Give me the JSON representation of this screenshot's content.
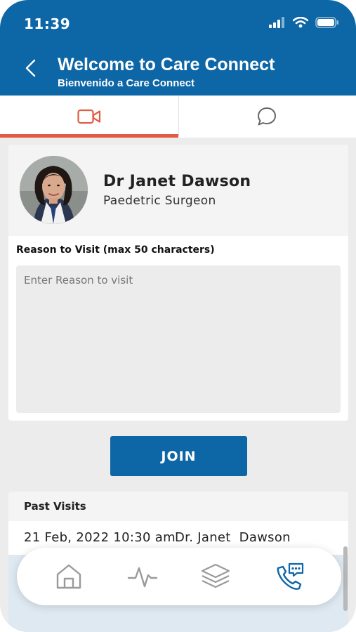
{
  "status_bar": {
    "time": "11:39"
  },
  "header": {
    "title": "Welcome to Care Connect",
    "subtitle": "Bienvenido a Care Connect"
  },
  "tabs": [
    {
      "icon": "video-camera-icon",
      "active": true
    },
    {
      "icon": "chat-bubble-icon",
      "active": false
    }
  ],
  "doctor": {
    "name": "Dr Janet Dawson",
    "role": "Paedetric Surgeon"
  },
  "visit_form": {
    "reason_label": "Reason to Visit (max 50 characters)",
    "reason_placeholder": "Enter Reason to visit",
    "reason_value": ""
  },
  "join_button": {
    "label": "JOIN"
  },
  "past_visits": {
    "title": "Past Visits",
    "items": [
      {
        "datetime": "21 Feb, 2022 10:30 am",
        "doctor": "Dr. Janet  Dawson"
      }
    ]
  },
  "bottom_nav": [
    {
      "icon": "home-icon",
      "active": false
    },
    {
      "icon": "pulse-icon",
      "active": false
    },
    {
      "icon": "layers-icon",
      "active": false
    },
    {
      "icon": "phone-chat-icon",
      "active": true
    }
  ],
  "colors": {
    "primary": "#0d66a6",
    "accent": "#e05c45",
    "inactive_icon": "#9a9a9a"
  }
}
